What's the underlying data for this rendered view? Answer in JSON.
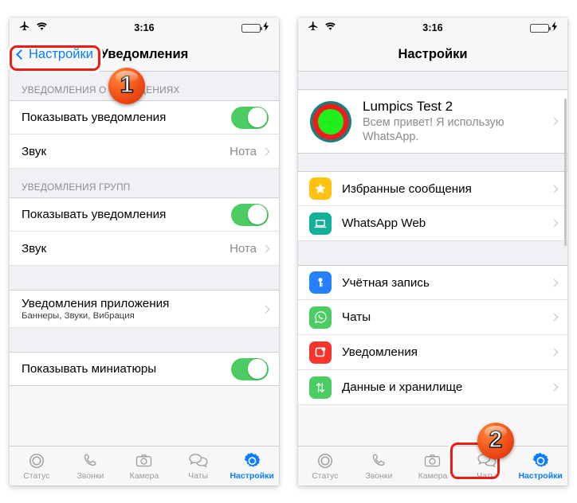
{
  "statusbar": {
    "time": "3:16",
    "airplane_icon": "airplane-icon",
    "wifi_icon": "wifi-icon",
    "battery_icon": "battery-low-icon",
    "charging_icon": "charging-bolt-icon"
  },
  "left_phone": {
    "nav": {
      "back_label": "Настройки",
      "title": "Уведомления"
    },
    "sections": [
      {
        "header": "УВЕДОМЛЕНИЯ О СООБЩЕНИЯХ",
        "rows": [
          {
            "title": "Показывать уведомления",
            "type": "toggle",
            "on": true
          },
          {
            "title": "Звук",
            "type": "value",
            "value": "Нота"
          }
        ]
      },
      {
        "header": "УВЕДОМЛЕНИЯ ГРУПП",
        "rows": [
          {
            "title": "Показывать уведомления",
            "type": "toggle",
            "on": true
          },
          {
            "title": "Звук",
            "type": "value",
            "value": "Нота"
          }
        ]
      },
      {
        "header": "",
        "rows": [
          {
            "title": "Уведомления приложения",
            "subtitle": "Баннеры, Звуки, Вибрация",
            "type": "disclosure"
          }
        ]
      },
      {
        "header": "",
        "rows": [
          {
            "title": "Показывать миниатюры",
            "type": "toggle",
            "on": true
          }
        ]
      }
    ]
  },
  "right_phone": {
    "nav": {
      "title": "Настройки"
    },
    "profile": {
      "name": "Lumpics Test 2",
      "status": "Всем привет! Я использую WhatsApp.",
      "avatar_icon": "lime-slice-avatar"
    },
    "groups": [
      {
        "rows": [
          {
            "label": "Избранные сообщения",
            "icon": "star-icon",
            "color": "#ffc20e"
          },
          {
            "label": "WhatsApp Web",
            "icon": "laptop-icon",
            "color": "#12b09a"
          }
        ]
      },
      {
        "rows": [
          {
            "label": "Учётная запись",
            "icon": "key-icon",
            "color": "#2680ff"
          },
          {
            "label": "Чаты",
            "icon": "whatsapp-icon",
            "color": "#4ccd63"
          },
          {
            "label": "Уведомления",
            "icon": "notification-badge-icon",
            "color": "#f6362d"
          },
          {
            "label": "Данные и хранилище",
            "icon": "data-arrows-icon",
            "color": "#4ccd63"
          }
        ]
      }
    ]
  },
  "tabbar": {
    "tabs": [
      {
        "label": "Статус",
        "icon": "status-rings-icon"
      },
      {
        "label": "Звонки",
        "icon": "phone-icon"
      },
      {
        "label": "Камера",
        "icon": "camera-icon"
      },
      {
        "label": "Чаты",
        "icon": "chats-bubbles-icon"
      },
      {
        "label": "Настройки",
        "icon": "settings-gear-icon"
      }
    ],
    "active_index": 4
  },
  "annotations": {
    "badge_one": "1",
    "badge_two": "2",
    "accent_color": "#ee1c12"
  }
}
